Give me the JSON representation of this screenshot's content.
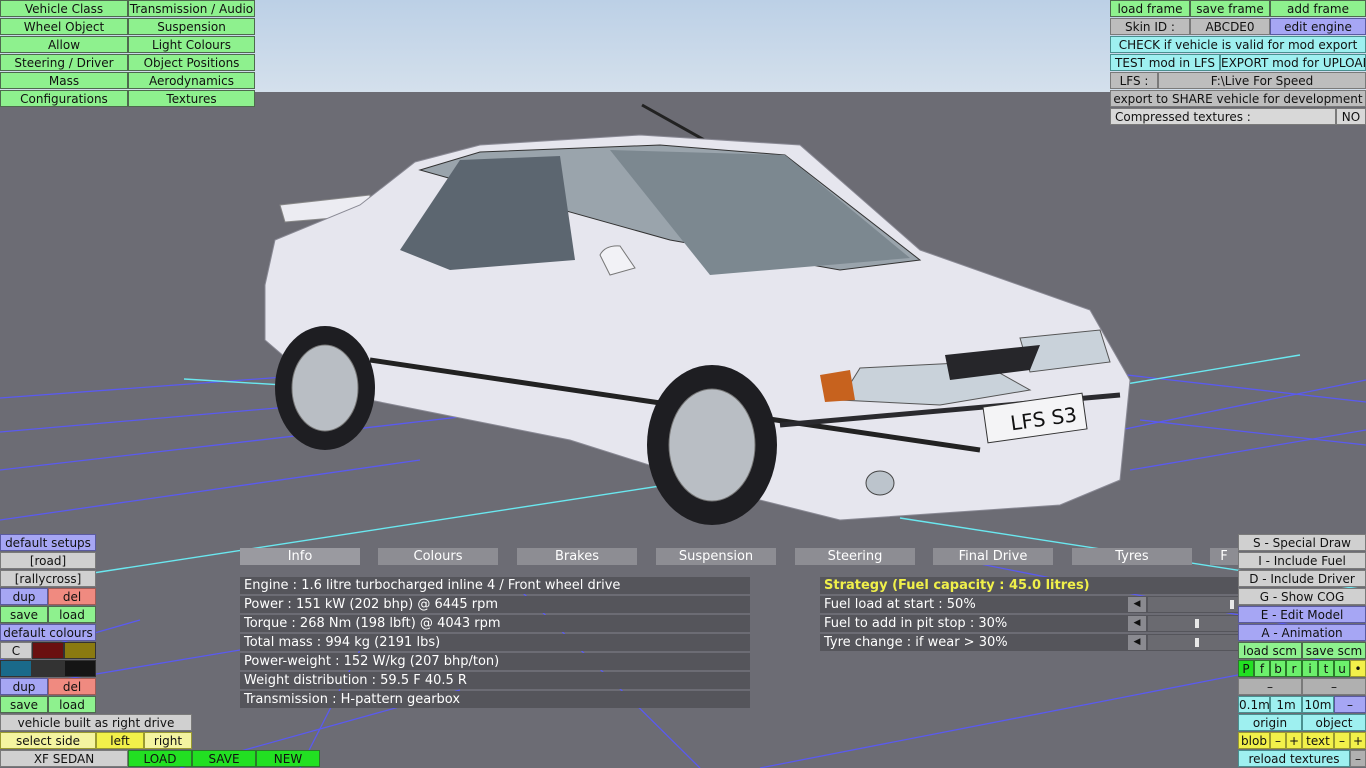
{
  "top_left_menu": [
    [
      "Vehicle Class",
      "Transmission / Audio"
    ],
    [
      "Wheel Object",
      "Suspension"
    ],
    [
      "Allow",
      "Light Colours"
    ],
    [
      "Steering / Driver",
      "Object Positions"
    ],
    [
      "Mass",
      "Aerodynamics"
    ],
    [
      "Configurations",
      "Textures"
    ]
  ],
  "top_right": {
    "load_frame": "load frame",
    "save_frame": "save frame",
    "add_frame": "add frame",
    "skin_id_label": "Skin ID :",
    "skin_id_value": "ABCDE0",
    "edit_engine": "edit engine",
    "check_valid": "CHECK if vehicle is valid for mod export",
    "test_mod": "TEST mod in LFS",
    "export_mod": "EXPORT mod for UPLOAD",
    "lfs_label": "LFS :",
    "lfs_path": "F:\\Live For Speed",
    "export_share": "export to SHARE vehicle for development",
    "compressed_label": "Compressed textures :",
    "compressed_value": "NO"
  },
  "car": {
    "plate": "LFS S3",
    "colour": "#e6e6ee"
  },
  "tabs": [
    "Info",
    "Colours",
    "Brakes",
    "Suspension",
    "Steering",
    "Final Drive",
    "Tyres",
    "F"
  ],
  "active_tab": "Info",
  "info": [
    "Engine : 1.6 litre turbocharged inline 4 / Front wheel drive",
    "Power : 151 kW (202 bhp) @ 6445 rpm",
    "Torque : 268 Nm (198 lbft) @ 4043 rpm",
    "Total mass : 994 kg (2191 lbs)",
    "Power-weight : 152 W/kg (207 bhp/ton)",
    "Weight distribution : 59.5 F  40.5 R",
    "Transmission : H-pattern gearbox"
  ],
  "strategy": {
    "title": "Strategy (Fuel capacity : 45.0 litres)",
    "rows": [
      {
        "label": "Fuel load at start : 50%",
        "level": 0.95
      },
      {
        "label": "Fuel to add in pit stop : 30%",
        "level": 0.55
      },
      {
        "label": "Tyre change : if wear > 30%",
        "level": 0.55
      }
    ]
  },
  "left_bottom": {
    "default_setups": "default setups",
    "road": "[road]",
    "rallycross": "[rallycross]",
    "dup": "dup",
    "del": "del",
    "save": "save",
    "load": "load",
    "default_colours": "default colours",
    "c": "C",
    "colour_swatches": [
      "#6a1010",
      "#8a7a10",
      "#1a6a8a",
      "#333333",
      "#151515"
    ],
    "built_as": "vehicle built as right drive",
    "select_side": "select side",
    "left": "left",
    "right": "right",
    "vehicle_name": "XF SEDAN",
    "load_btn": "LOAD",
    "save_btn": "SAVE",
    "new_btn": "NEW"
  },
  "right_bottom": {
    "special_draw": "S - Special Draw",
    "include_fuel": "I - Include Fuel",
    "include_driver": "D - Include Driver",
    "show_cog": "G - Show COG",
    "edit_model": "E - Edit Model",
    "animation": "A - Animation",
    "load_scm": "load scm",
    "save_scm": "save scm",
    "flags": [
      "P",
      "f",
      "b",
      "r",
      "i",
      "t",
      "u",
      "•"
    ],
    "dash1": "–",
    "dash2": "–",
    "d01": "0.1m",
    "d1": "1m",
    "d10": "10m",
    "dminus": "–",
    "origin": "origin",
    "object": "object",
    "blob": "blob",
    "minus": "–",
    "plus": "+",
    "text": "text",
    "reload": "reload textures",
    "reload_minus": "–"
  }
}
